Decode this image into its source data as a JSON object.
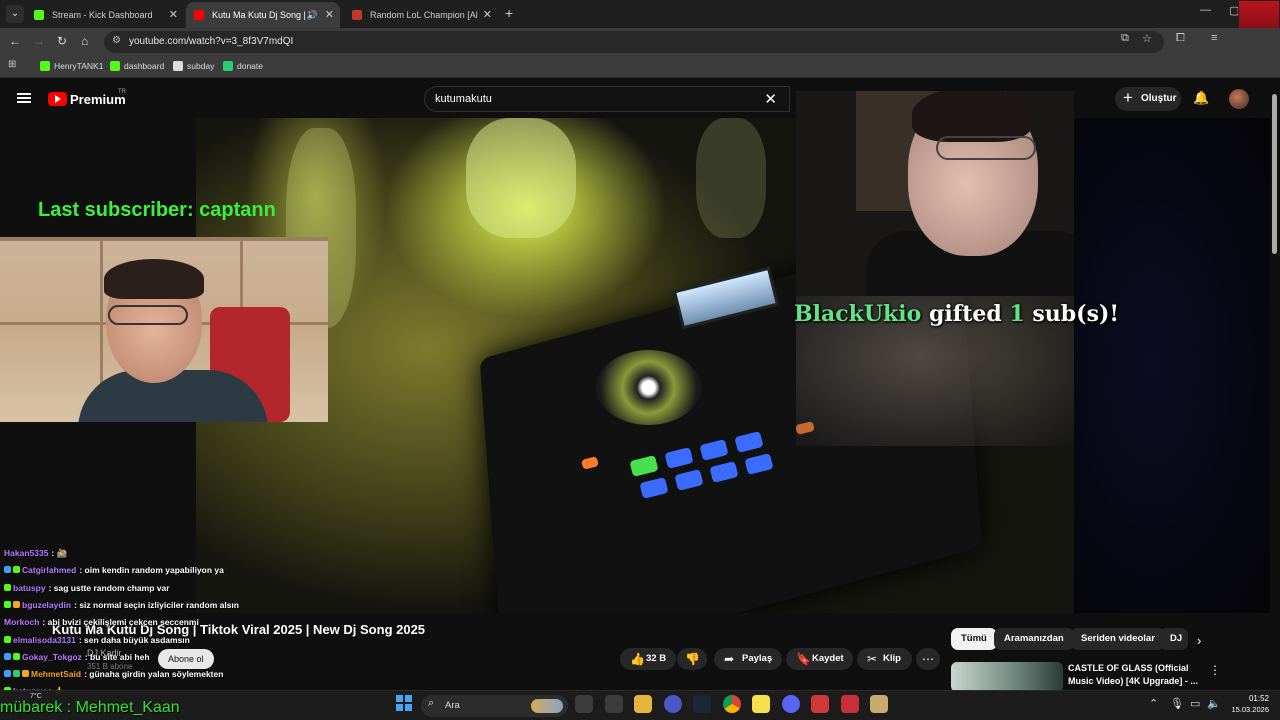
{
  "browser": {
    "tabs": [
      {
        "label": "Stream - Kick Dashboard",
        "favicon_color": "#53fc18",
        "active": false
      },
      {
        "label": "Kutu Ma Kutu Dj Song | Tikto",
        "favicon_color": "#ff0000",
        "active": true
      },
      {
        "label": "Random LoL Champion [All Ch",
        "favicon_color": "#c0392b",
        "active": false
      }
    ],
    "url": "youtube.com/watch?v=3_8f3V7mdQI",
    "bookmarks": [
      {
        "label": "HenryTANK1",
        "favicon_color": "#53fc18"
      },
      {
        "label": "dashboard",
        "favicon_color": "#53fc18"
      },
      {
        "label": "subday",
        "favicon_color": "#dddddd"
      },
      {
        "label": "donate",
        "favicon_color": "#2ecc71"
      }
    ]
  },
  "youtube": {
    "logo_text": "Premium",
    "country_code": "TR",
    "search_query": "kutumakutu",
    "create_label": "Oluştur",
    "video_title": "Kutu Ma Kutu Dj Song | Tiktok Viral 2025 | New Dj Song 2025",
    "channel_name": "DJ Kadir",
    "subscriber_count": "351 B abone",
    "subscribe_label": "Abone ol",
    "actions": {
      "likes": "32 B",
      "share": "Paylaş",
      "save": "Kaydet",
      "clip": "Klip"
    },
    "chips": [
      "Tümü",
      "Aramanızdan",
      "Seriden videolar",
      "DJ"
    ],
    "recommended": {
      "title": "CASTLE OF GLASS (Official Music Video) [4K Upgrade] - ..."
    }
  },
  "overlay": {
    "last_subscriber": "Last subscriber: captann",
    "gift_alert": {
      "gifter": "BlackUkio",
      "middle": "gifted",
      "count": "1",
      "suffix": "sub(s)!"
    },
    "bottom_message": "mübarek : Mehmet_Kaan"
  },
  "chat": [
    {
      "user": "Hakan5335",
      "user_color": "#b57bff",
      "text": ": 🚵",
      "badges": []
    },
    {
      "user": "Catgirlahmed",
      "user_color": "#b57bff",
      "text": ": oim kendin random yapabiliyon ya",
      "badges": [
        "#3aa0ff",
        "#53fc18"
      ]
    },
    {
      "user": "batuspy",
      "user_color": "#b57bff",
      "text": ": sag ustte random champ var",
      "badges": [
        "#53fc18"
      ]
    },
    {
      "user": "bguzelaydin",
      "user_color": "#b57bff",
      "text": ": siz normal seçin izliyiciler random alsın",
      "badges": [
        "#53fc18",
        "#f5a623"
      ]
    },
    {
      "user": "Morkoch",
      "user_color": "#b57bff",
      "text": ": abi bvizi çekilişlemi çekcen seccenmi",
      "badges": []
    },
    {
      "user": "elmalisoda3131",
      "user_color": "#b57bff",
      "text": ": sen daha büyük asdamsın",
      "badges": [
        "#53fc18"
      ]
    },
    {
      "user": "Gokay_Tokgoz",
      "user_color": "#b57bff",
      "text": ": bu site abi heh",
      "badges": [
        "#3aa0ff",
        "#53fc18"
      ]
    },
    {
      "user": "MehmetSaid",
      "user_color": "#f5a623",
      "text": ": günaha girdin yalan söylemekten",
      "badges": [
        "#3aa0ff",
        "#2ecc71",
        "#f5a623"
      ]
    },
    {
      "user": "batuspy",
      "user_color": "#b57bff",
      "text": ": 👍",
      "badges": [
        "#53fc18"
      ]
    }
  ],
  "taskbar": {
    "search_placeholder": "Ara",
    "time": "01:52",
    "date": "15.03.2026",
    "weather": "7°C",
    "pinned_icons": [
      "file-explorer-icon",
      "calculator-icon",
      "folder-icon",
      "obs-icon",
      "steam-icon",
      "chrome-icon",
      "notes-icon",
      "discord-icon",
      "riot-icon",
      "league-client-icon",
      "lol-icon"
    ]
  }
}
